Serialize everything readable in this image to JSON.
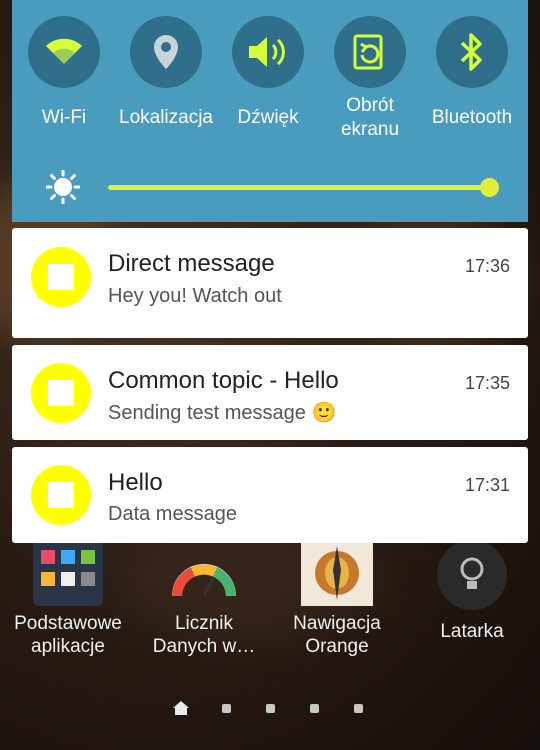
{
  "quick_settings": {
    "tiles": [
      {
        "label": "Wi-Fi",
        "icon": "wifi-icon"
      },
      {
        "label": "Lokalizacja",
        "icon": "location-icon"
      },
      {
        "label": "Dźwięk",
        "icon": "sound-icon"
      },
      {
        "label": "Obrót\nekranu",
        "icon": "rotate-screen-icon"
      },
      {
        "label": "Bluetooth",
        "icon": "bluetooth-icon"
      }
    ],
    "brightness": {
      "icon": "brightness-icon",
      "level": 1.0
    },
    "colors": {
      "panel": "#4a9cbe",
      "tile_bg": "#2f6f8c",
      "accent": "#d6ff3a"
    }
  },
  "notifications": [
    {
      "title": "Direct message",
      "text": "Hey you! Watch out",
      "time": "17:36"
    },
    {
      "title": "Common topic - Hello",
      "text": "Sending test message 🙂",
      "time": "17:35"
    },
    {
      "title": "Hello",
      "text": "Data message",
      "time": "17:31"
    }
  ],
  "apps": [
    {
      "name": "Podstawowe\naplikacje",
      "icon": "folder-icon"
    },
    {
      "name": "Licznik\nDanych w…",
      "icon": "gauge-icon"
    },
    {
      "name": "Nawigacja\nOrange",
      "icon": "navigation-icon"
    },
    {
      "name": "Latarka",
      "icon": "flashlight-icon"
    }
  ],
  "page_indicator": {
    "pages": 5,
    "current": 0
  }
}
